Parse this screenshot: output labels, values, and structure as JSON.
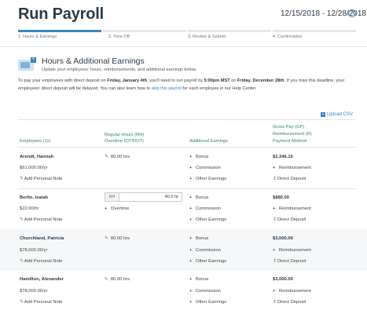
{
  "header": {
    "title": "Run Payroll",
    "date_range": "12/15/2018 - 12/28/2018",
    "help_icon": "question-circle-icon"
  },
  "steps": [
    {
      "label": "1. Hours & Earnings",
      "active": true
    },
    {
      "label": "2. Time Off",
      "active": false
    },
    {
      "label": "3. Review & Submit",
      "active": false
    },
    {
      "label": "4. Confirmation",
      "active": false
    }
  ],
  "section": {
    "icon": "earnings-icon",
    "title": "Hours & Additional Earnings",
    "subtitle": "Update your employees' hours, reimbursements, and additional earnings below.",
    "note": {
      "p1": "To pay your employees with direct deposit on ",
      "b1": "Friday, January 4th",
      "p2": ", you'll need to run payroll by ",
      "b2": "5:00pm MST",
      "p3": " on ",
      "b3": "Friday, December 28th",
      "p4": ". If you miss this deadline, your employees' direct deposit will be delayed. You can also learn how to ",
      "link": "skip this payroll",
      "p5": " for each employee in our Help Center."
    }
  },
  "upload_csv": "Upload CSV",
  "table": {
    "headers": {
      "employees": "Employees (11)",
      "hours_l1": "Regular Hours (RH)",
      "hours_l2": "Overtime (OT/DOT)",
      "additional": "Additional Earnings",
      "gross_l1": "Gross Pay (GP)",
      "gross_l2": "Reimbursement (R)",
      "gross_l3": "Payment Method"
    },
    "add_note": "Add Personal Note",
    "bonus": "Bonus",
    "commission": "Commission",
    "other": "Other Earnings",
    "reimbursement": "Reimbursement",
    "direct_deposit": "Direct Deposit",
    "rows": [
      {
        "name": "Arendt, Hannah",
        "rate": "$61,000.00/yr",
        "hours": "80.00 hrs",
        "gross": "$2,346.15"
      },
      {
        "name": "Berlin, Isaiah",
        "rate": "$22.00/hr",
        "rh_tag": "RH",
        "rh_value": "40.0 hr",
        "overtime": "Overtime",
        "gross": "$880.00"
      },
      {
        "name": "Churchland, Patricia",
        "rate": "$78,000.00/yr",
        "hours": "80.00 hrs",
        "gross": "$3,000.00"
      },
      {
        "name": "Hamilton, Alexander",
        "rate": "$78,000.00/yr",
        "hours": "80.00 hrs",
        "gross": "$3,000.00"
      }
    ]
  }
}
